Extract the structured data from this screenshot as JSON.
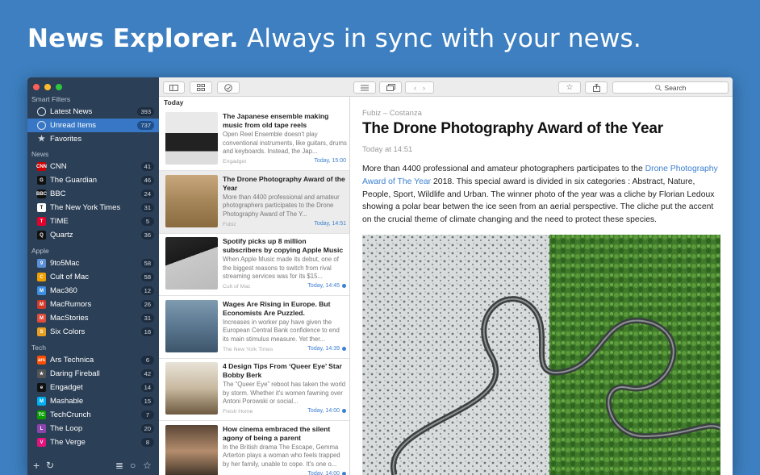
{
  "headline": {
    "bold": "News Explorer.",
    "rest": "Always in sync with your news."
  },
  "sidebar": {
    "sections": [
      {
        "title": "Smart Filters",
        "items": [
          {
            "label": "Latest News",
            "count": "393",
            "icon": "clock-icon",
            "color": "#2b3f56"
          },
          {
            "label": "Unread Items",
            "count": "737",
            "icon": "circle-icon",
            "color": "#2b3f56"
          },
          {
            "label": "Favorites",
            "count": "",
            "icon": "star-icon",
            "color": "#2b3f56"
          }
        ]
      },
      {
        "title": "News",
        "items": [
          {
            "label": "CNN",
            "count": "41",
            "icon": "CNN",
            "color": "#cc0000"
          },
          {
            "label": "The Guardian",
            "count": "46",
            "icon": "G",
            "color": "#111111"
          },
          {
            "label": "BBC",
            "count": "24",
            "icon": "BBC",
            "color": "#111111"
          },
          {
            "label": "The New York Times",
            "count": "31",
            "icon": "T",
            "color": "#ffffff"
          },
          {
            "label": "TIME",
            "count": "5",
            "icon": "T",
            "color": "#e4002b"
          },
          {
            "label": "Quartz",
            "count": "36",
            "icon": "Q",
            "color": "#111111"
          }
        ]
      },
      {
        "title": "Apple",
        "items": [
          {
            "label": "9to5Mac",
            "count": "58",
            "icon": "9",
            "color": "#5b8fd6"
          },
          {
            "label": "Cult of Mac",
            "count": "58",
            "icon": "C",
            "color": "#f0a000"
          },
          {
            "label": "Mac360",
            "count": "12",
            "icon": "M",
            "color": "#3d8ee0"
          },
          {
            "label": "MacRumors",
            "count": "26",
            "icon": "M",
            "color": "#d23a2a"
          },
          {
            "label": "MacStories",
            "count": "31",
            "icon": "M",
            "color": "#e14b3a"
          },
          {
            "label": "Six Colors",
            "count": "18",
            "icon": "S",
            "color": "#e8a020"
          }
        ]
      },
      {
        "title": "Tech",
        "items": [
          {
            "label": "Ars Technica",
            "count": "6",
            "icon": "ars",
            "color": "#ff4e00"
          },
          {
            "label": "Daring Fireball",
            "count": "42",
            "icon": "★",
            "color": "#555555"
          },
          {
            "label": "Engadget",
            "count": "14",
            "icon": "e",
            "color": "#111111"
          },
          {
            "label": "Mashable",
            "count": "15",
            "icon": "M",
            "color": "#00aeef"
          },
          {
            "label": "TechCrunch",
            "count": "7",
            "icon": "TC",
            "color": "#0a9e01"
          },
          {
            "label": "The Loop",
            "count": "20",
            "icon": "L",
            "color": "#8e44ad"
          },
          {
            "label": "The Verge",
            "count": "8",
            "icon": "V",
            "color": "#e5127d"
          }
        ]
      }
    ]
  },
  "list": {
    "day": "Today",
    "articles": [
      {
        "title": "The Japanese ensemble making music from old tape reels",
        "snippet": "Open Reel Ensemble doesn't play conventional instruments, like guitars, drums and keyboards. Instead, the Jap...",
        "source": "Engadget",
        "time": "Today, 15:00",
        "unread": false
      },
      {
        "title": "The Drone Photography Award of the Year",
        "snippet": "More than 4400 professional and amateur photographers participates to the Drone Photography Award of The Y...",
        "source": "Fubiz",
        "time": "Today, 14:51",
        "unread": false
      },
      {
        "title": "Spotify picks up 8 million subscribers by copying Apple Music",
        "snippet": "When Apple Music made its debut, one of the biggest reasons to switch from rival streaming services was for its $15...",
        "source": "Cult of Mac",
        "time": "Today, 14:45",
        "unread": true
      },
      {
        "title": "Wages Are Rising in Europe. But Economists Are Puzzled.",
        "snippet": "Increases in worker pay have given the European Central Bank confidence to end its main stimulus measure. Yet ther...",
        "source": "The New York Times",
        "time": "Today, 14:39",
        "unread": true
      },
      {
        "title": "4 Design Tips From ‘Queer Eye’ Star Bobby Berk",
        "snippet": "The “Queer Eye” reboot has taken the world by storm. Whether it's women fawning over Antoni Porowski or social...",
        "source": "Fresh Home",
        "time": "Today, 14:00",
        "unread": true
      },
      {
        "title": "How cinema embraced the silent agony of being a parent",
        "snippet": "In the British drama The Escape, Gemma Arterton plays a woman who feels trapped by her family, unable to cope. It's one o...",
        "source": "",
        "time": "Today, 14:00",
        "unread": true
      }
    ]
  },
  "reader": {
    "search_placeholder": "Search",
    "meta": "Fubiz – Costanza",
    "title": "The Drone Photography Award of the Year",
    "date": "Today at 14:51",
    "body_pre": "More than 4400 professional and amateur photographers participates to the ",
    "body_link": "Drone Photography Award of The Year",
    "body_post": " 2018. This special award is divided in six categories : Abstract, Nature, People, Sport, Wildlife and Urban. The winner photo of the year was a cliche by Florian Ledoux showing a polar bear betwen the ice seen from an aerial perspective. The cliche put the accent on the crucial theme of climate changing and the need to protect these species."
  }
}
